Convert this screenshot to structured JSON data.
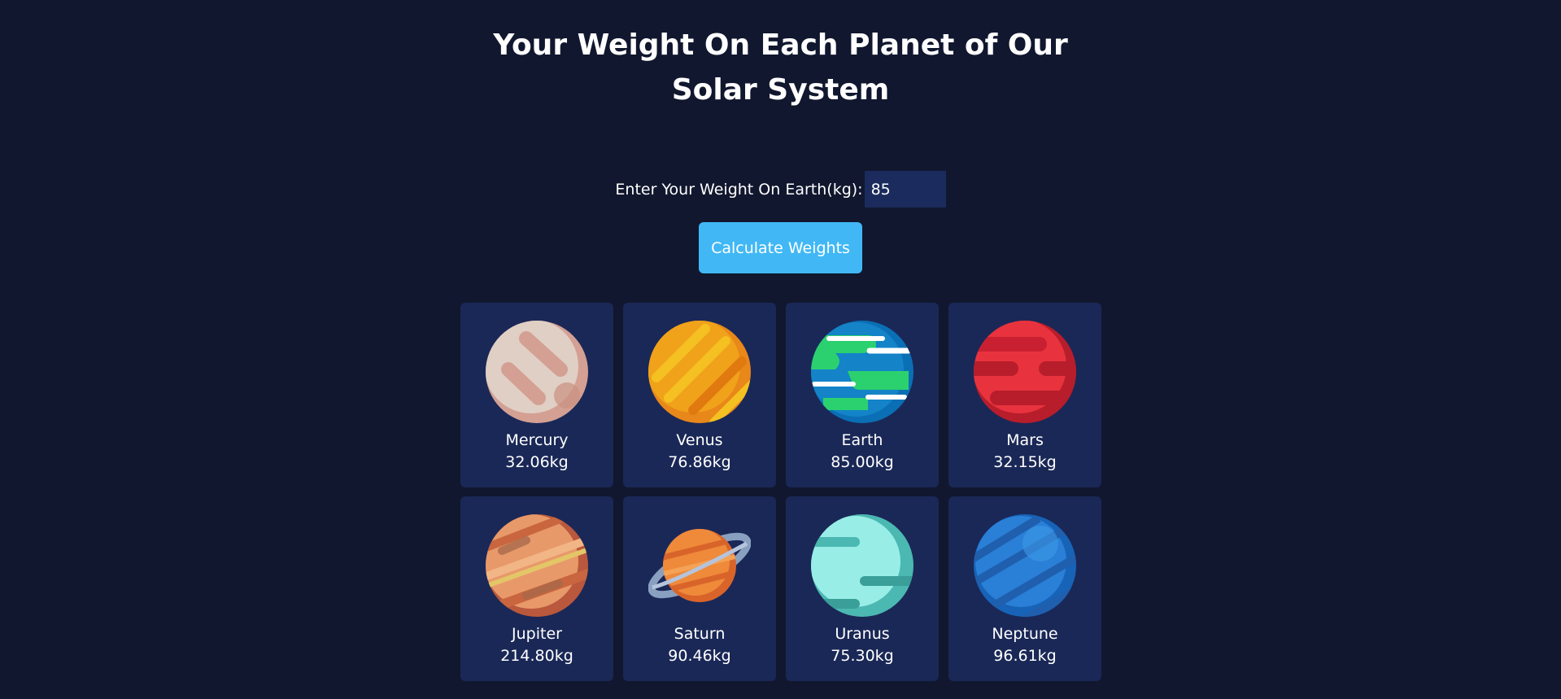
{
  "title": "Your Weight On Each Planet of Our Solar System",
  "form": {
    "label": "Enter Your Weight On Earth(kg):",
    "value": "85",
    "button_label": "Calculate Weights"
  },
  "planets": [
    {
      "name": "Mercury",
      "weight": "32.06kg",
      "icon": "mercury-icon"
    },
    {
      "name": "Venus",
      "weight": "76.86kg",
      "icon": "venus-icon"
    },
    {
      "name": "Earth",
      "weight": "85.00kg",
      "icon": "earth-icon"
    },
    {
      "name": "Mars",
      "weight": "32.15kg",
      "icon": "mars-icon"
    },
    {
      "name": "Jupiter",
      "weight": "214.80kg",
      "icon": "jupiter-icon"
    },
    {
      "name": "Saturn",
      "weight": "90.46kg",
      "icon": "saturn-icon"
    },
    {
      "name": "Uranus",
      "weight": "75.30kg",
      "icon": "uranus-icon"
    },
    {
      "name": "Neptune",
      "weight": "96.61kg",
      "icon": "neptune-icon"
    }
  ],
  "colors": {
    "background": "#11172e",
    "card": "#1a2857",
    "input": "#1b2b5e",
    "button": "#41b8f5"
  }
}
